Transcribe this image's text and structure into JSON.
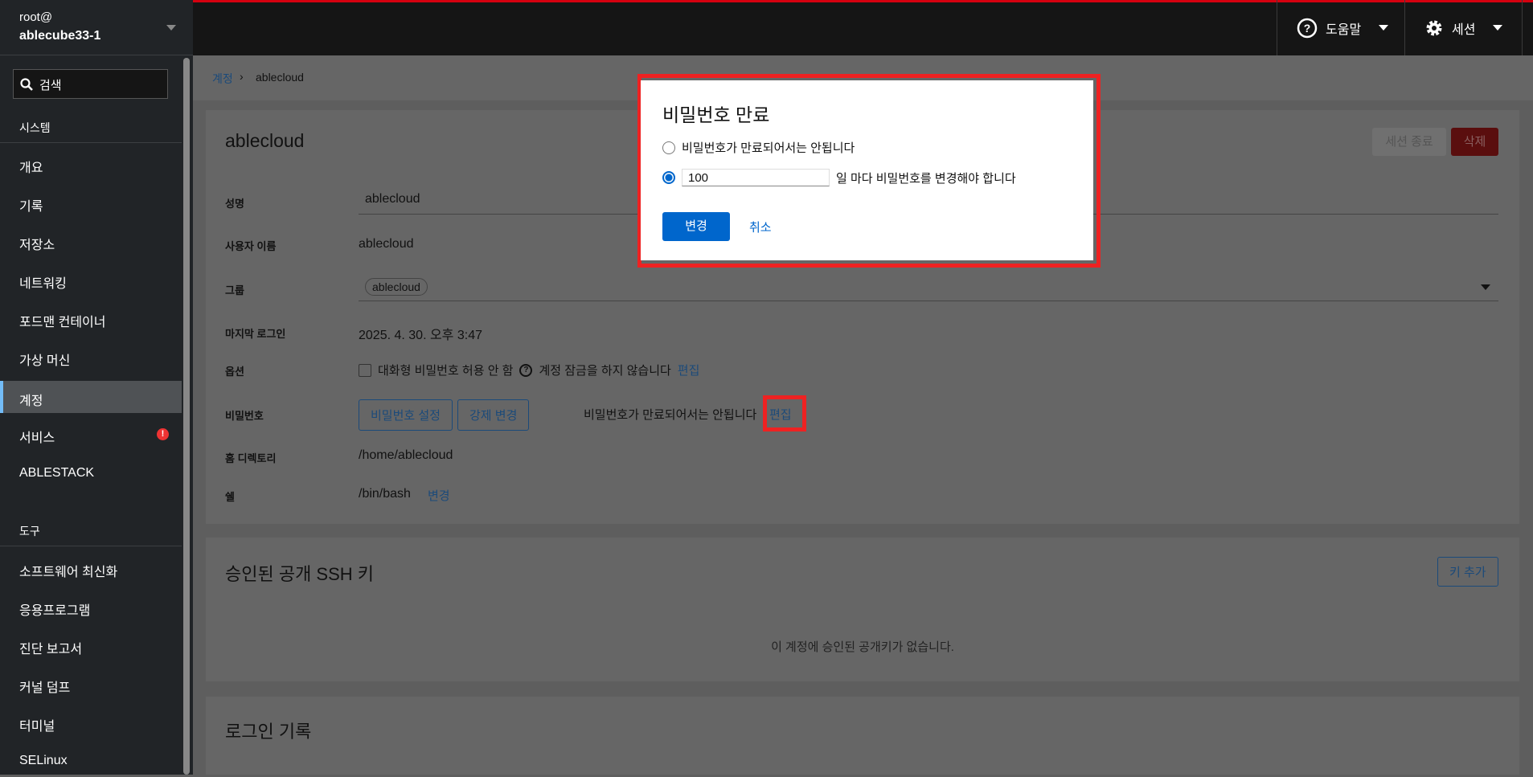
{
  "host": {
    "user": "root@",
    "name": "ablecube33-1"
  },
  "search": {
    "placeholder": "검색"
  },
  "sidebar": {
    "system_header": "시스템",
    "tools_header": "도구",
    "items": [
      "개요",
      "기록",
      "저장소",
      "네트워킹",
      "포드맨 컨테이너",
      "가상 머신",
      "계정",
      "서비스",
      "ABLESTACK"
    ],
    "tools": [
      "소프트웨어 최신화",
      "응용프로그램",
      "진단 보고서",
      "커널 덤프",
      "터미널",
      "SELinux"
    ]
  },
  "topbar": {
    "help": "도움말",
    "session": "세션"
  },
  "breadcrumb": {
    "parent": "계정",
    "current": "ablecloud"
  },
  "account": {
    "title": "ablecloud",
    "end_session": "세션 종료",
    "delete": "삭제",
    "fields": {
      "full_name_label": "성명",
      "full_name": "ablecloud",
      "username_label": "사용자 이름",
      "username": "ablecloud",
      "group_label": "그룹",
      "group": "ablecloud",
      "last_login_label": "마지막 로그인",
      "last_login": "2025. 4. 30. 오후 3:47",
      "options_label": "옵션",
      "no_interactive_pw": "대화형 비밀번호 허용 안 함",
      "no_lock": "계정 잠금을 하지 않습니다",
      "edit": "편집",
      "password_label": "비밀번호",
      "set_password": "비밀번호 설정",
      "force_change": "강제 변경",
      "pw_status": "비밀번호가 만료되어서는 안됩니다",
      "home_label": "홈 디렉토리",
      "home": "/home/ablecloud",
      "shell_label": "쉘",
      "shell": "/bin/bash",
      "change": "변경"
    }
  },
  "ssh": {
    "title": "승인된 공개 SSH 키",
    "add": "키 추가",
    "empty": "이 계정에 승인된 공개키가 없습니다."
  },
  "login_history": {
    "title": "로그인 기록"
  },
  "dialog": {
    "title": "비밀번호 만료",
    "never": "비밀번호가 만료되어서는 안됩니다",
    "days_value": "100",
    "days_suffix": "일 마다 비밀번호를 변경해야 합니다",
    "confirm": "변경",
    "cancel": "취소"
  }
}
